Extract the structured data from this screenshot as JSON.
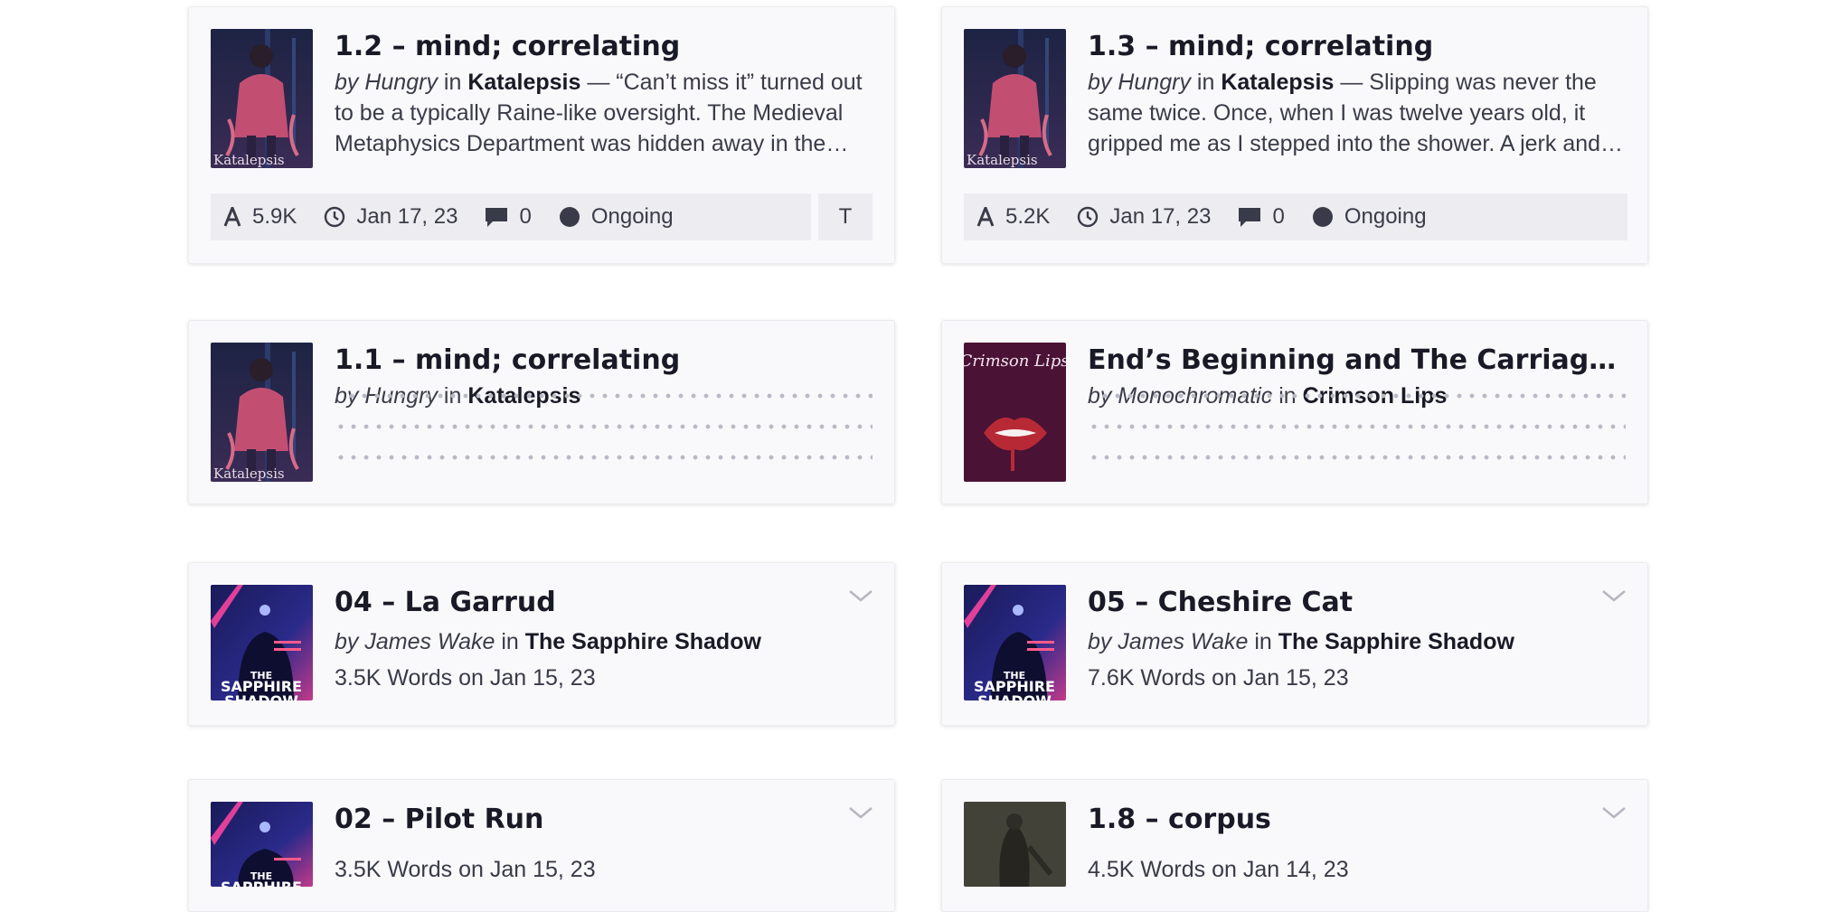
{
  "cards": [
    {
      "title": "1.2 – mind; correlating",
      "by": "by Hungry",
      "in": "in",
      "story": "Katalepsis",
      "excerpt": "— “Can’t miss it” turned out to be a typically Raine-like oversight. The Medieval Metaphysics Department was hidden away in the library, tucked into a corner.",
      "stats": {
        "words": "5.9K",
        "date": "Jan 17, 23",
        "comments": "0",
        "status": "Ongoing"
      },
      "extra_button": "T",
      "cover": "katalepsis-cover"
    },
    {
      "title": "1.3 – mind; correlating",
      "by": "by Hungry",
      "in": "in",
      "story": "Katalepsis",
      "excerpt": "— Slipping was never the same twice. Once, when I was twelve years old, it gripped me as I stepped into the shower. A jerk and a lurch, and the world fell away.",
      "stats": {
        "words": "5.2K",
        "date": "Jan 17, 23",
        "comments": "0",
        "status": "Ongoing"
      },
      "cover": "katalepsis-cover"
    },
    {
      "title": "1.1 – mind; correlating",
      "by": "by Hungry",
      "in": "in",
      "story": "Katalepsis",
      "cover": "katalepsis-cover"
    },
    {
      "title": "End’s Beginning and The Carriage that Carried Us",
      "by": "by Monochromatic",
      "in": "in",
      "story": "Crimson Lips",
      "cover": "crimson-lips-cover",
      "cover_text": "Crimson Lips"
    },
    {
      "title": "04 – La Garrud",
      "by": "by James Wake",
      "in": "in",
      "story": "The Sapphire Shadow",
      "words_line": "3.5K Words on Jan 15, 23",
      "cover": "sapphire-shadow-cover",
      "cover_text": [
        "THE",
        "SAPPHIRE",
        "SHADOW"
      ]
    },
    {
      "title": "05 – Cheshire Cat",
      "by": "by James Wake",
      "in": "in",
      "story": "The Sapphire Shadow",
      "words_line": "7.6K Words on Jan 15, 23",
      "cover": "sapphire-shadow-cover",
      "cover_text": [
        "THE",
        "SAPPHIRE",
        "SHADOW"
      ]
    },
    {
      "title": "02 – Pilot Run",
      "words_line": "3.5K Words on Jan 15, 23",
      "cover": "sapphire-shadow-cover",
      "cover_text": [
        "THE",
        "SAPPHIRE"
      ]
    },
    {
      "title": "1.8 – corpus",
      "words_line": "4.5K Words on Jan 14, 23",
      "cover": "dark-figure-cover"
    }
  ],
  "cover_label": "Katalepsis",
  "colors": {
    "card_bg": "#f9f9fb",
    "stats_bg": "#ededf1",
    "text_dark": "#191a26",
    "text_muted": "#3a3b48",
    "crimson_bg": "#4a1235",
    "lips": "#b72a35"
  }
}
